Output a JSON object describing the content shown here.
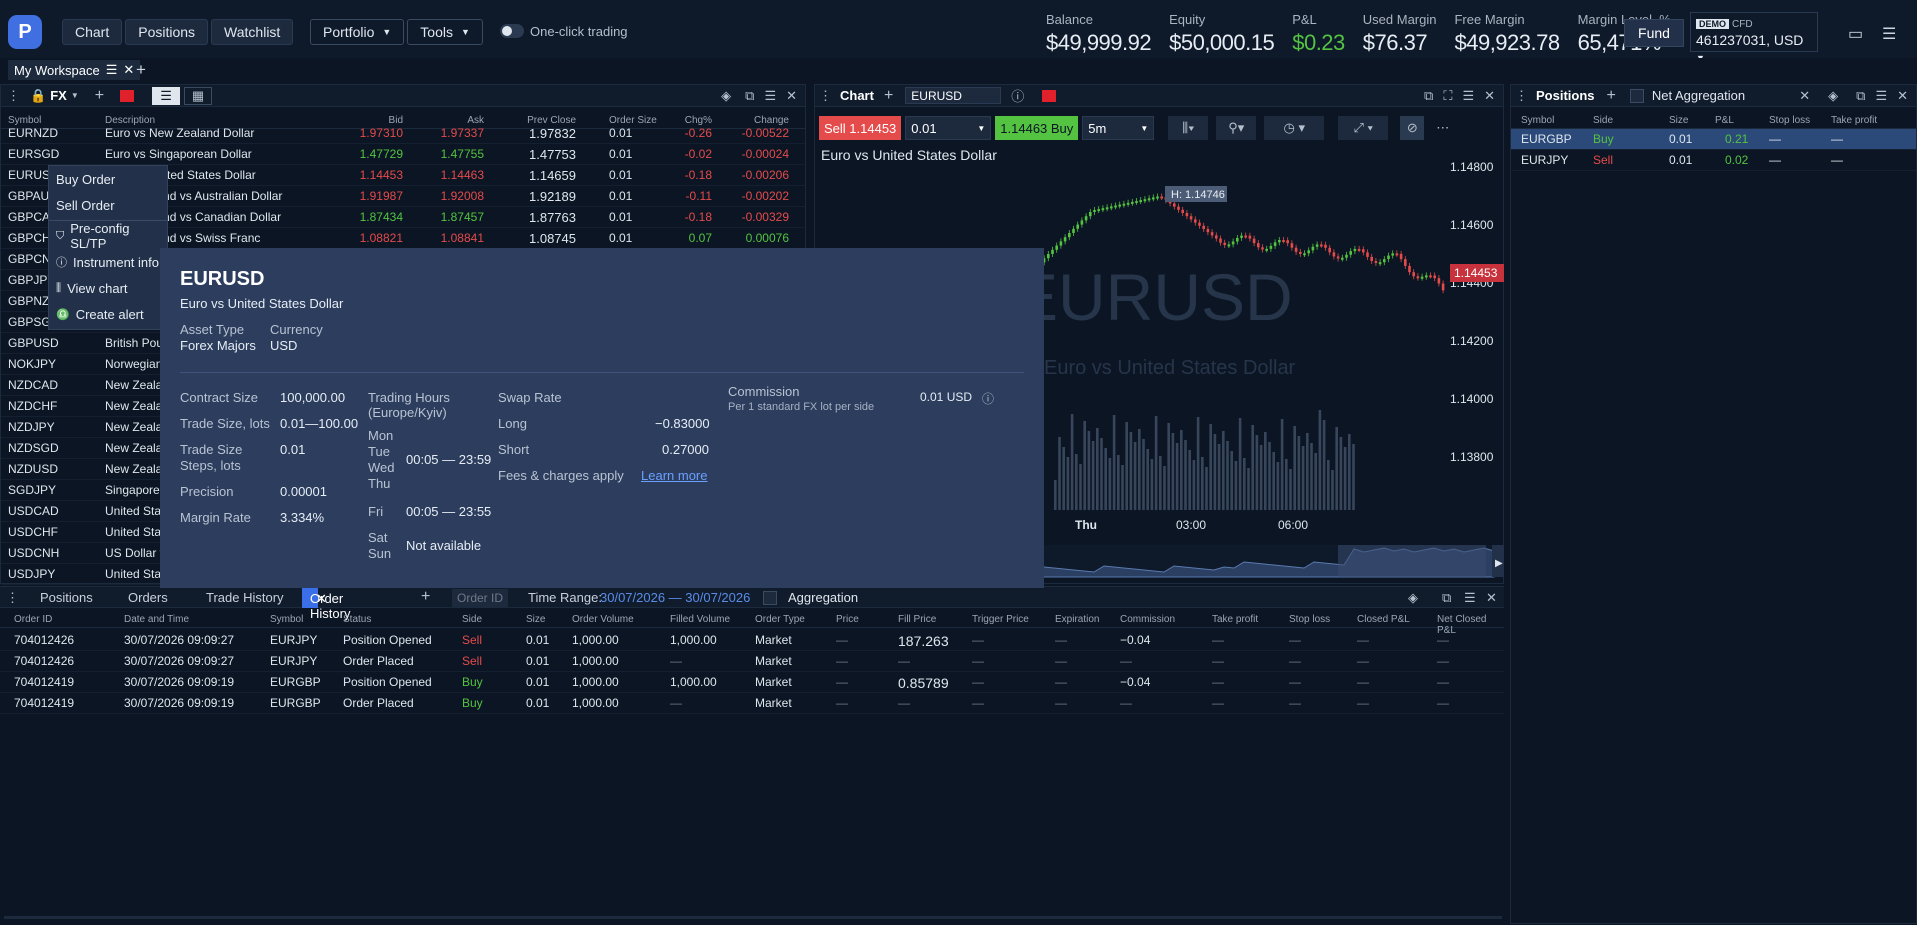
{
  "topbar": {
    "logo": "P",
    "nav": [
      "Chart",
      "Positions",
      "Watchlist"
    ],
    "portfolio": "Portfolio",
    "tools": "Tools",
    "one_click": "One-click trading",
    "stats": [
      {
        "label": "Balance",
        "value": "$49,999.92",
        "color": "#e7edf4"
      },
      {
        "label": "Equity",
        "value": "$50,000.15",
        "color": "#e7edf4"
      },
      {
        "label": "P&L",
        "value": "$0.23",
        "color": "#54c341"
      },
      {
        "label": "Used Margin",
        "value": "$76.37",
        "color": "#e7edf4"
      },
      {
        "label": "Free Margin",
        "value": "$49,923.78",
        "color": "#e7edf4"
      },
      {
        "label": "Margin Level, %",
        "value": "65,471%",
        "color": "#e7edf4"
      }
    ],
    "fund": "Fund",
    "demo": "DEMO",
    "cfd": "CFD",
    "account": "461237031, USD"
  },
  "workspace": {
    "tab": "My Workspace"
  },
  "watchlist": {
    "group": "FX",
    "columns": [
      "Symbol",
      "Description",
      "Bid",
      "Ask",
      "Prev Close",
      "Order Size",
      "Chg%",
      "Change"
    ],
    "rows": [
      [
        "EURNZD",
        "Euro vs New Zealand Dollar",
        "1.97310",
        "1.97337",
        "1.97832",
        "0.01",
        "-0.26",
        "-0.00522",
        "dn"
      ],
      [
        "EURSGD",
        "Euro vs Singaporean Dollar",
        "1.47729",
        "1.47755",
        "1.47753",
        "0.01",
        "-0.02",
        "-0.00024",
        "up"
      ],
      [
        "EURUSD",
        "Euro vs United States Dollar",
        "1.14453",
        "1.14463",
        "1.14659",
        "0.01",
        "-0.18",
        "-0.00206",
        "dn"
      ],
      [
        "GBPAUD",
        "British Pound vs Australian Dollar",
        "1.91987",
        "1.92008",
        "1.92189",
        "0.01",
        "-0.11",
        "-0.00202",
        "dn"
      ],
      [
        "GBPCAD",
        "British Pound vs Canadian Dollar",
        "1.87434",
        "1.87457",
        "1.87763",
        "0.01",
        "-0.18",
        "-0.00329",
        "up"
      ],
      [
        "GBPCHF",
        "British Pound vs Swiss Franc",
        "1.08821",
        "1.08841",
        "1.08745",
        "0.01",
        "0.07",
        "0.00076",
        "dn"
      ],
      [
        "GBPCNH",
        "",
        "",
        "",
        "",
        "",
        "",
        "",
        ""
      ],
      [
        "GBPJPY",
        "",
        "",
        "",
        "",
        "",
        "",
        "",
        ""
      ],
      [
        "GBPNZD",
        "",
        "",
        "",
        "",
        "",
        "",
        "",
        ""
      ],
      [
        "GBPSGD",
        "",
        "",
        "",
        "",
        "",
        "",
        "",
        ""
      ],
      [
        "GBPUSD",
        "British Pou",
        "",
        "",
        "",
        "",
        "",
        "",
        ""
      ],
      [
        "NOKJPY",
        "Norwegian",
        "",
        "",
        "",
        "",
        "",
        "",
        ""
      ],
      [
        "NZDCAD",
        "New Zeala",
        "",
        "",
        "",
        "",
        "",
        "",
        ""
      ],
      [
        "NZDCHF",
        "New Zeala",
        "",
        "",
        "",
        "",
        "",
        "",
        ""
      ],
      [
        "NZDJPY",
        "New Zeala",
        "",
        "",
        "",
        "",
        "",
        "",
        ""
      ],
      [
        "NZDSGD",
        "New Zeala",
        "",
        "",
        "",
        "",
        "",
        "",
        ""
      ],
      [
        "NZDUSD",
        "New Zeala",
        "",
        "",
        "",
        "",
        "",
        "",
        ""
      ],
      [
        "SGDJPY",
        "Singapore",
        "",
        "",
        "",
        "",
        "",
        "",
        ""
      ],
      [
        "USDCAD",
        "United Sta",
        "",
        "",
        "",
        "",
        "",
        "",
        ""
      ],
      [
        "USDCHF",
        "United Sta",
        "",
        "",
        "",
        "",
        "",
        "",
        ""
      ],
      [
        "USDCNH",
        "US Dollar v",
        "",
        "",
        "",
        "",
        "",
        "",
        ""
      ],
      [
        "USDJPY",
        "United Sta",
        "",
        "",
        "",
        "",
        "",
        "",
        ""
      ]
    ]
  },
  "context_menu": [
    "Buy Order",
    "Sell Order",
    "Pre-config SL/TP",
    "Instrument info",
    "View chart",
    "Create alert"
  ],
  "instrument_info": {
    "symbol": "EURUSD",
    "name": "Euro vs United States Dollar",
    "asset_type_label": "Asset Type",
    "asset_type": "Forex Majors",
    "currency_label": "Currency",
    "currency": "USD",
    "contract_size_label": "Contract Size",
    "contract_size": "100,000.00",
    "trade_size_label": "Trade Size, lots",
    "trade_size": "0.01—100.00",
    "steps_label1": "Trade Size",
    "steps_label2": "Steps, lots",
    "steps": "0.01",
    "precision_label": "Precision",
    "precision": "0.00001",
    "margin_label": "Margin Rate",
    "margin": "3.334%",
    "hours_label1": "Trading Hours",
    "hours_label2": "(Europe/Kyiv)",
    "days1": [
      "Mon",
      "Tue",
      "Wed",
      "Thu"
    ],
    "hours1": "00:05 — 23:59",
    "day_fri": "Fri",
    "hours_fri": "00:05 — 23:55",
    "days_weekend": [
      "Sat",
      "Sun"
    ],
    "hours_weekend": "Not available",
    "swap_label": "Swap Rate",
    "long_label": "Long",
    "long": "−0.83000",
    "short_label": "Short",
    "short": "0.27000",
    "fees": "Fees & charges apply",
    "learn_more": "Learn more",
    "commission_label": "Commission",
    "commission_note": "Per 1 standard FX lot per side",
    "commission": "0.01 USD"
  },
  "chart": {
    "title": "Chart",
    "symbol": "EURUSD",
    "sell": "Sell 1.14453",
    "qty": "0.01",
    "buy": "1.14463 Buy",
    "timeframe": "5m",
    "instrument_name": "Euro vs United States Dollar",
    "watermark_symbol": "EURUSD",
    "watermark_name": "Euro vs United States Dollar",
    "high_label": "H: 1.14746",
    "last_price": "1.14453",
    "yticks": [
      "1.14800",
      "1.14600",
      "1.14400",
      "1.14200",
      "1.14000",
      "1.13800"
    ],
    "xticks": [
      "Thu",
      "03:00",
      "06:00"
    ]
  },
  "positions": {
    "title": "Positions",
    "aggregation": "Net Aggregation",
    "columns": [
      "Symbol",
      "Side",
      "Size",
      "P&L",
      "Stop loss",
      "Take profit"
    ],
    "rows": [
      [
        "EURGBP",
        "Buy",
        "0.01",
        "0.21",
        "—",
        "—"
      ],
      [
        "EURJPY",
        "Sell",
        "0.01",
        "0.02",
        "—",
        "—"
      ]
    ]
  },
  "orders": {
    "tabs": [
      "Positions",
      "Orders",
      "Trade History",
      "Order History"
    ],
    "order_id_placeholder": "Order ID",
    "time_range_label": "Time Range:",
    "time_range": "30/07/2026 — 30/07/2026",
    "aggregation": "Aggregation",
    "columns": [
      "Order ID",
      "Date and Time",
      "Symbol",
      "Status",
      "Side",
      "Size",
      "Order Volume",
      "Filled Volume",
      "Order Type",
      "Price",
      "Fill Price",
      "Trigger Price",
      "Expiration",
      "Commission",
      "Take profit",
      "Stop loss",
      "Closed P&L",
      "Net Closed P&L"
    ],
    "rows": [
      [
        "704012426",
        "30/07/2026 09:09:27",
        "EURJPY",
        "Position Opened",
        "Sell",
        "0.01",
        "1,000.00",
        "1,000.00",
        "Market",
        "—",
        "187.263",
        "—",
        "—",
        "−0.04",
        "—",
        "—",
        "—",
        "—"
      ],
      [
        "704012426",
        "30/07/2026 09:09:27",
        "EURJPY",
        "Order Placed",
        "Sell",
        "0.01",
        "1,000.00",
        "—",
        "Market",
        "—",
        "—",
        "—",
        "—",
        "—",
        "—",
        "—",
        "—",
        "—"
      ],
      [
        "704012419",
        "30/07/2026 09:09:19",
        "EURGBP",
        "Position Opened",
        "Buy",
        "0.01",
        "1,000.00",
        "1,000.00",
        "Market",
        "—",
        "0.85789",
        "—",
        "—",
        "−0.04",
        "—",
        "—",
        "—",
        "—"
      ],
      [
        "704012419",
        "30/07/2026 09:09:19",
        "EURGBP",
        "Order Placed",
        "Buy",
        "0.01",
        "1,000.00",
        "—",
        "Market",
        "—",
        "—",
        "—",
        "—",
        "—",
        "—",
        "—",
        "—",
        "—"
      ]
    ]
  }
}
